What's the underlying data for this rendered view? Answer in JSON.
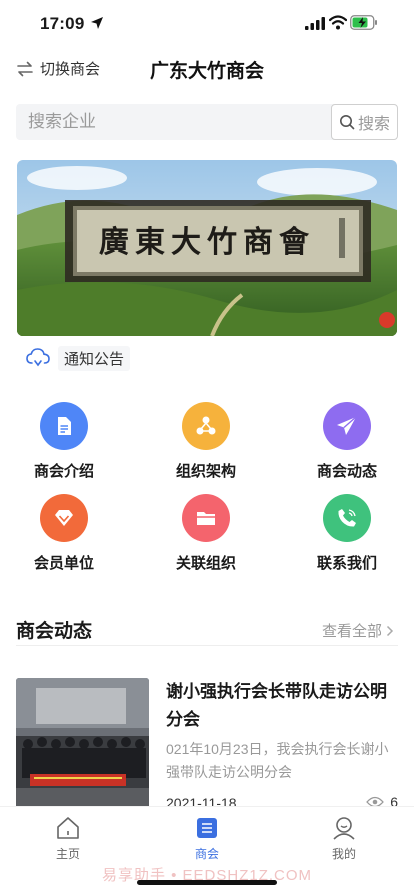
{
  "status_bar": {
    "time": "17:09"
  },
  "header": {
    "switch_label": "切换商会",
    "title": "广东大竹商会"
  },
  "search": {
    "placeholder": "搜索企业",
    "button_label": "搜索"
  },
  "banner": {
    "calligraphy": "廣東大竹商會"
  },
  "notice": {
    "label": "通知公告"
  },
  "grid": {
    "items": [
      {
        "label": "商会介绍",
        "icon": "document-icon",
        "color": "#4f86f7"
      },
      {
        "label": "组织架构",
        "icon": "org-structure-icon",
        "color": "#f6b23c"
      },
      {
        "label": "商会动态",
        "icon": "paper-plane-icon",
        "color": "#8e6cf0"
      },
      {
        "label": "会员单位",
        "icon": "diamond-icon",
        "color": "#f26a3a"
      },
      {
        "label": "关联组织",
        "icon": "folder-icon",
        "color": "#f4646d"
      },
      {
        "label": "联系我们",
        "icon": "phone-icon",
        "color": "#3fc27d"
      }
    ]
  },
  "section": {
    "title": "商会动态",
    "view_all": "查看全部"
  },
  "news": [
    {
      "title": "谢小强执行会长带队走访公明分会",
      "summary": "021年10月23日，我会执行会长谢小强带队走访公明分会",
      "date": "2021-11-18",
      "views": "6"
    }
  ],
  "tabbar": {
    "tabs": [
      {
        "label": "主页",
        "icon": "home-icon"
      },
      {
        "label": "商会",
        "icon": "chamber-icon",
        "active": true
      },
      {
        "label": "我的",
        "icon": "profile-icon"
      }
    ]
  },
  "watermark": "易享助手 • EEDSHZ1Z.COM",
  "colors": {
    "accent": "#3b6fe0"
  }
}
